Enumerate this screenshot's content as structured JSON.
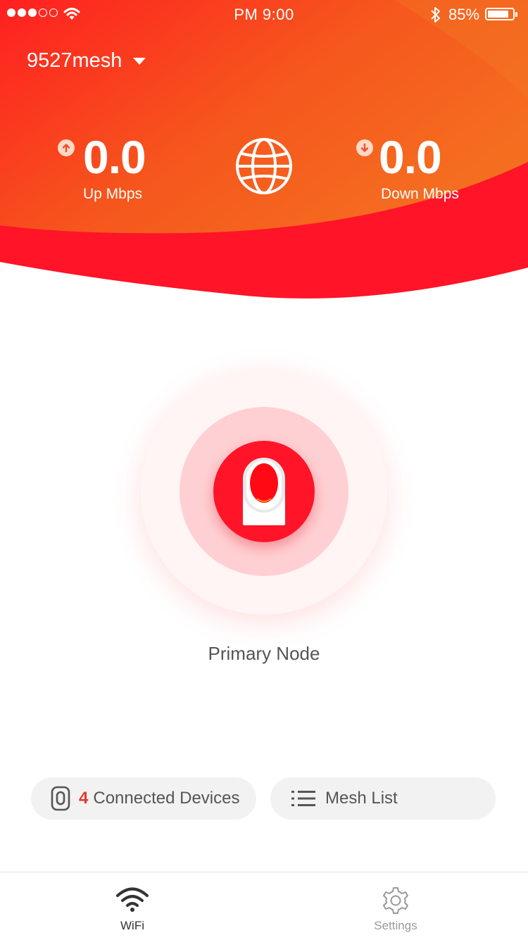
{
  "status_bar": {
    "signal_dots": [
      true,
      true,
      true,
      false,
      false
    ],
    "clock": "PM  9:00",
    "battery_percent": "85%",
    "battery_level": 0.85
  },
  "header": {
    "network_name": "9527mesh",
    "upload": {
      "value": "0.0",
      "label": "Up Mbps"
    },
    "download": {
      "value": "0.0",
      "label": "Down Mbps"
    },
    "gradient_colors": [
      "#ff2a2a",
      "#f4631d",
      "#ff1428"
    ]
  },
  "node": {
    "label": "Primary Node",
    "accent_color": "#ff1428"
  },
  "actions": {
    "devices": {
      "count": "4",
      "label": "Connected Devices",
      "icon": "device-icon"
    },
    "mesh": {
      "label": "Mesh List",
      "icon": "list-icon"
    }
  },
  "tabbar": {
    "tabs": [
      {
        "label": "WiFi",
        "icon": "wifi-icon",
        "active": true
      },
      {
        "label": "Settings",
        "icon": "gear-icon",
        "active": false
      }
    ]
  }
}
